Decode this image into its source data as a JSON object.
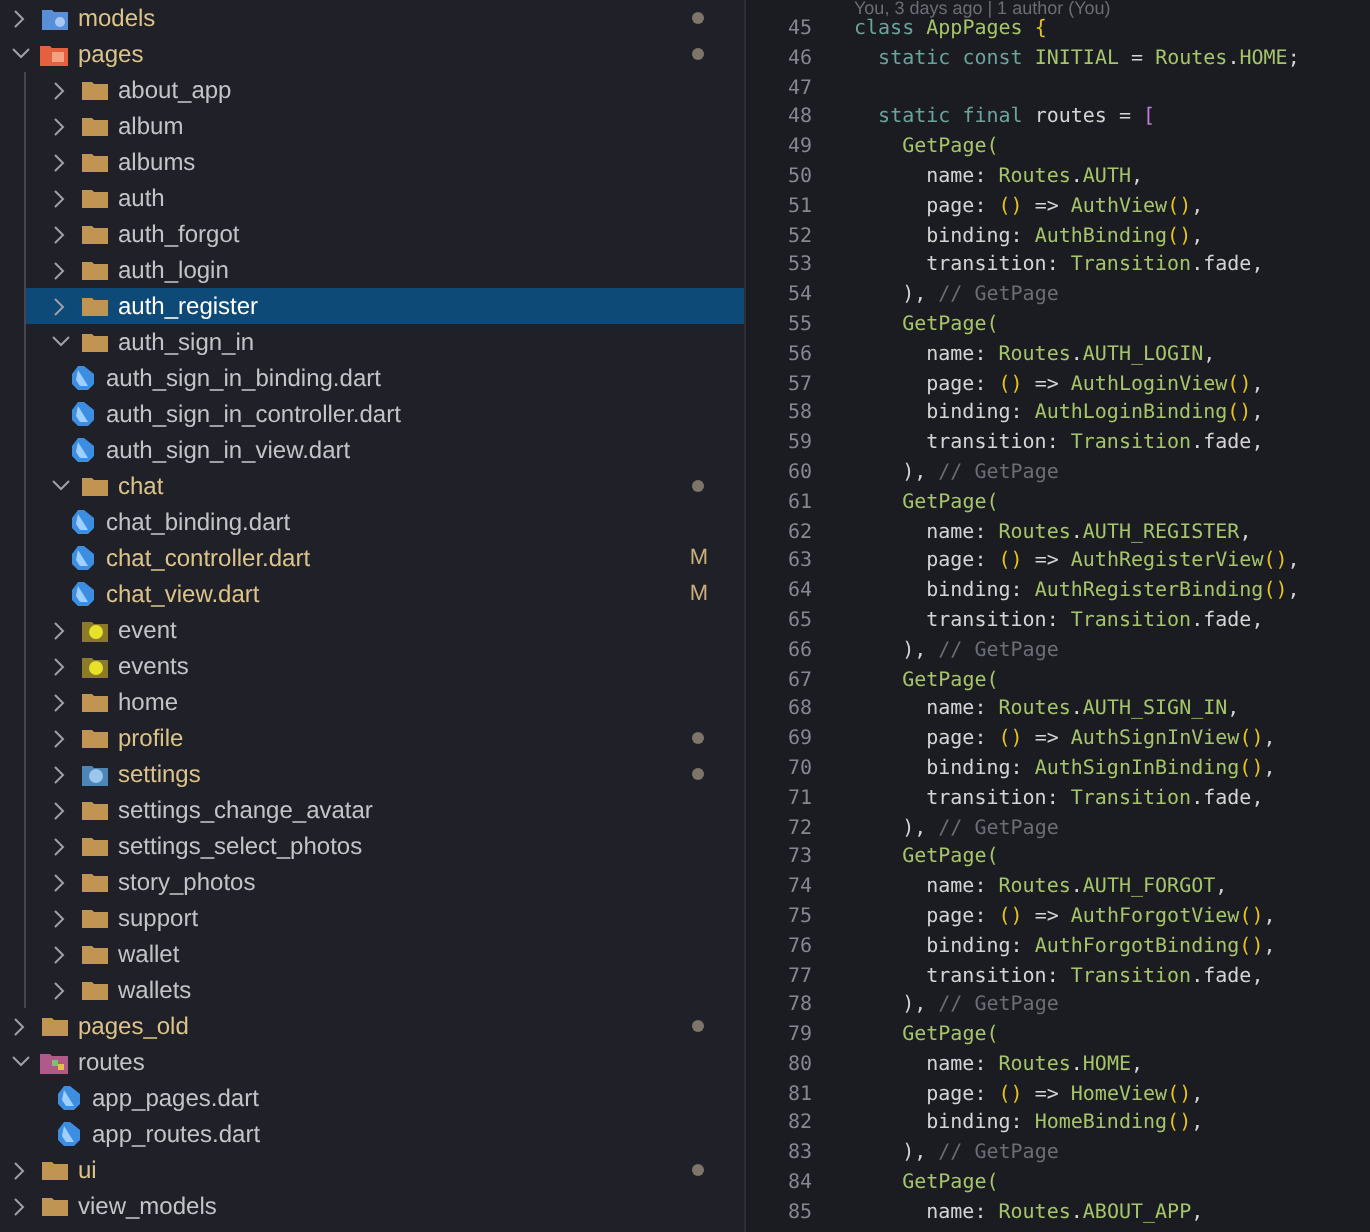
{
  "explorer": {
    "items": [
      {
        "name": "models",
        "kind": "blue-folder",
        "expanded": false,
        "selected": false,
        "modified": true
      },
      {
        "name": "pages",
        "kind": "red-folder",
        "expanded": true,
        "selected": false,
        "modified": true,
        "children": [
          {
            "name": "about_app",
            "kind": "folder",
            "expanded": false,
            "selected": false,
            "modified": false
          },
          {
            "name": "album",
            "kind": "folder",
            "expanded": false,
            "selected": false,
            "modified": false
          },
          {
            "name": "albums",
            "kind": "folder",
            "expanded": false,
            "selected": false,
            "modified": false
          },
          {
            "name": "auth",
            "kind": "folder",
            "expanded": false,
            "selected": false,
            "modified": false
          },
          {
            "name": "auth_forgot",
            "kind": "folder",
            "expanded": false,
            "selected": false,
            "modified": false
          },
          {
            "name": "auth_login",
            "kind": "folder",
            "expanded": false,
            "selected": false,
            "modified": false
          },
          {
            "name": "auth_register",
            "kind": "folder",
            "expanded": false,
            "selected": true,
            "modified": false
          },
          {
            "name": "auth_sign_in",
            "kind": "folder",
            "expanded": true,
            "selected": false,
            "modified": false,
            "children": [
              {
                "name": "auth_sign_in_binding.dart",
                "kind": "dart-file",
                "selected": false,
                "modified": false
              },
              {
                "name": "auth_sign_in_controller.dart",
                "kind": "dart-file",
                "selected": false,
                "modified": false
              },
              {
                "name": "auth_sign_in_view.dart",
                "kind": "dart-file",
                "selected": false,
                "modified": false
              }
            ]
          },
          {
            "name": "chat",
            "kind": "folder",
            "expanded": true,
            "selected": false,
            "modified": true,
            "children": [
              {
                "name": "chat_binding.dart",
                "kind": "dart-file",
                "selected": false,
                "modified": false
              },
              {
                "name": "chat_controller.dart",
                "kind": "dart-file",
                "selected": false,
                "modified": true,
                "badge": "M"
              },
              {
                "name": "chat_view.dart",
                "kind": "dart-file",
                "selected": false,
                "modified": true,
                "badge": "M"
              }
            ]
          },
          {
            "name": "event",
            "kind": "gear-folder",
            "expanded": false,
            "selected": false,
            "modified": false
          },
          {
            "name": "events",
            "kind": "gear-folder",
            "expanded": false,
            "selected": false,
            "modified": false
          },
          {
            "name": "home",
            "kind": "folder",
            "expanded": false,
            "selected": false,
            "modified": false
          },
          {
            "name": "profile",
            "kind": "folder",
            "expanded": false,
            "selected": false,
            "modified": true
          },
          {
            "name": "settings",
            "kind": "blue-gear-folder",
            "expanded": false,
            "selected": false,
            "modified": true
          },
          {
            "name": "settings_change_avatar",
            "kind": "folder",
            "expanded": false,
            "selected": false,
            "modified": false
          },
          {
            "name": "settings_select_photos",
            "kind": "folder",
            "expanded": false,
            "selected": false,
            "modified": false
          },
          {
            "name": "story_photos",
            "kind": "folder",
            "expanded": false,
            "selected": false,
            "modified": false
          },
          {
            "name": "support",
            "kind": "folder",
            "expanded": false,
            "selected": false,
            "modified": false
          },
          {
            "name": "wallet",
            "kind": "folder",
            "expanded": false,
            "selected": false,
            "modified": false
          },
          {
            "name": "wallets",
            "kind": "folder",
            "expanded": false,
            "selected": false,
            "modified": false
          }
        ]
      },
      {
        "name": "pages_old",
        "kind": "folder",
        "expanded": false,
        "selected": false,
        "modified": true
      },
      {
        "name": "routes",
        "kind": "mixed-folder",
        "expanded": true,
        "selected": false,
        "modified": false,
        "children": [
          {
            "name": "app_pages.dart",
            "kind": "dart-file",
            "selected": false,
            "modified": false
          },
          {
            "name": "app_routes.dart",
            "kind": "dart-file",
            "selected": false,
            "modified": false
          }
        ]
      },
      {
        "name": "ui",
        "kind": "folder",
        "expanded": false,
        "selected": false,
        "modified": true
      },
      {
        "name": "view_models",
        "kind": "folder",
        "expanded": false,
        "selected": false,
        "modified": false
      }
    ]
  },
  "editor": {
    "blame": "You, 3 days ago | 1 author (You)",
    "lines": [
      {
        "number": "45",
        "text": "class AppPages {"
      },
      {
        "number": "46",
        "text": "  static const INITIAL = Routes.HOME;"
      },
      {
        "number": "47"
      },
      {
        "number": "48",
        "text": "  static final routes = ["
      },
      {
        "number": "49",
        "text": "    GetPage("
      },
      {
        "number": "50",
        "text": "      name: Routes.AUTH,"
      },
      {
        "number": "51",
        "text": "      page: () => AuthView(),"
      },
      {
        "number": "52",
        "text": "      binding: AuthBinding(),"
      },
      {
        "number": "53",
        "text": "      transition: Transition.fade,"
      },
      {
        "number": "54",
        "text": "    ), // GetPage"
      },
      {
        "number": "55",
        "text": "    GetPage("
      },
      {
        "number": "56",
        "text": "      name: Routes.AUTH_LOGIN,"
      },
      {
        "number": "57",
        "text": "      page: () => AuthLoginView(),"
      },
      {
        "number": "58",
        "text": "      binding: AuthLoginBinding(),"
      },
      {
        "number": "59",
        "text": "      transition: Transition.fade,"
      },
      {
        "number": "60",
        "text": "    ), // GetPage"
      },
      {
        "number": "61",
        "text": "    GetPage("
      },
      {
        "number": "62",
        "text": "      name: Routes.AUTH_REGISTER,"
      },
      {
        "number": "63",
        "text": "      page: () => AuthRegisterView(),"
      },
      {
        "number": "64",
        "text": "      binding: AuthRegisterBinding(),"
      },
      {
        "number": "65",
        "text": "      transition: Transition.fade,"
      },
      {
        "number": "66",
        "text": "    ), // GetPage"
      },
      {
        "number": "67",
        "text": "    GetPage("
      },
      {
        "number": "68",
        "text": "      name: Routes.AUTH_SIGN_IN,"
      },
      {
        "number": "69",
        "text": "      page: () => AuthSignInView(),"
      },
      {
        "number": "70",
        "text": "      binding: AuthSignInBinding(),"
      },
      {
        "number": "71",
        "text": "      transition: Transition.fade,"
      },
      {
        "number": "72",
        "text": "    ), // GetPage"
      },
      {
        "number": "73",
        "text": "    GetPage("
      },
      {
        "number": "74",
        "text": "      name: Routes.AUTH_FORGOT,"
      },
      {
        "number": "75",
        "text": "      page: () => AuthForgotView(),"
      },
      {
        "number": "76",
        "text": "      binding: AuthForgotBinding(),"
      },
      {
        "number": "77",
        "text": "      transition: Transition.fade,"
      },
      {
        "number": "78",
        "text": "    ), // GetPage"
      },
      {
        "number": "79",
        "text": "    GetPage("
      },
      {
        "number": "80",
        "text": "      name: Routes.HOME,"
      },
      {
        "number": "81",
        "text": "      page: () => HomeView(),"
      },
      {
        "number": "82",
        "text": "      binding: HomeBinding(),"
      },
      {
        "number": "83",
        "text": "    ), // GetPage"
      },
      {
        "number": "84",
        "text": "    GetPage("
      },
      {
        "number": "85",
        "text": "      name: Routes.ABOUT_APP,"
      }
    ]
  }
}
